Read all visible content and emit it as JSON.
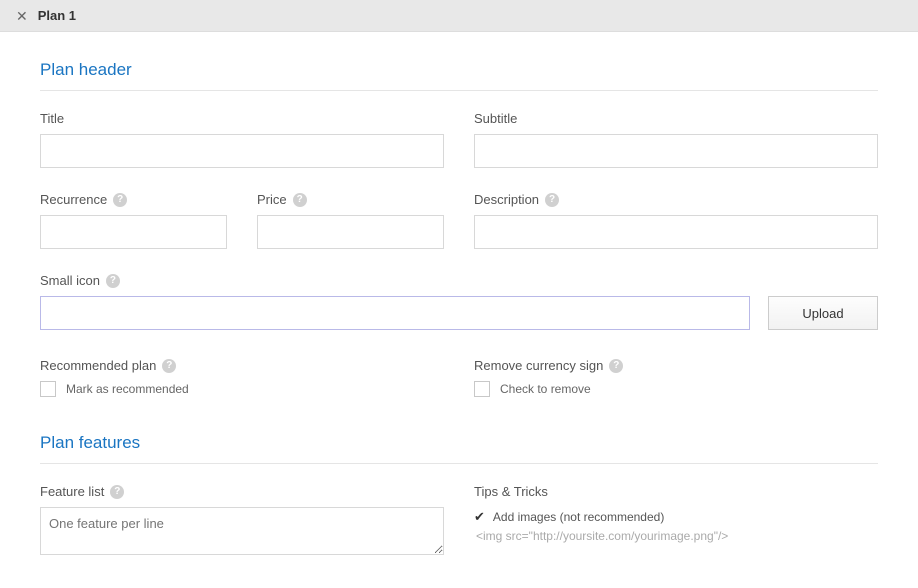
{
  "header": {
    "title": "Plan 1"
  },
  "sections": {
    "plan_header_title": "Plan header",
    "plan_features_title": "Plan features"
  },
  "fields": {
    "title_label": "Title",
    "subtitle_label": "Subtitle",
    "recurrence_label": "Recurrence",
    "price_label": "Price",
    "description_label": "Description",
    "small_icon_label": "Small icon",
    "upload_label": "Upload",
    "recommended_label": "Recommended plan",
    "recommended_checkbox": "Mark as recommended",
    "remove_currency_label": "Remove currency sign",
    "remove_currency_checkbox": "Check to remove",
    "feature_list_label": "Feature list",
    "feature_list_placeholder": "One feature per line",
    "tips_title": "Tips & Tricks",
    "tip1": "Add images (not recommended)",
    "tip1_code": "<img src=\"http://yoursite.com/yourimage.png\"/>"
  },
  "help_char": "?"
}
